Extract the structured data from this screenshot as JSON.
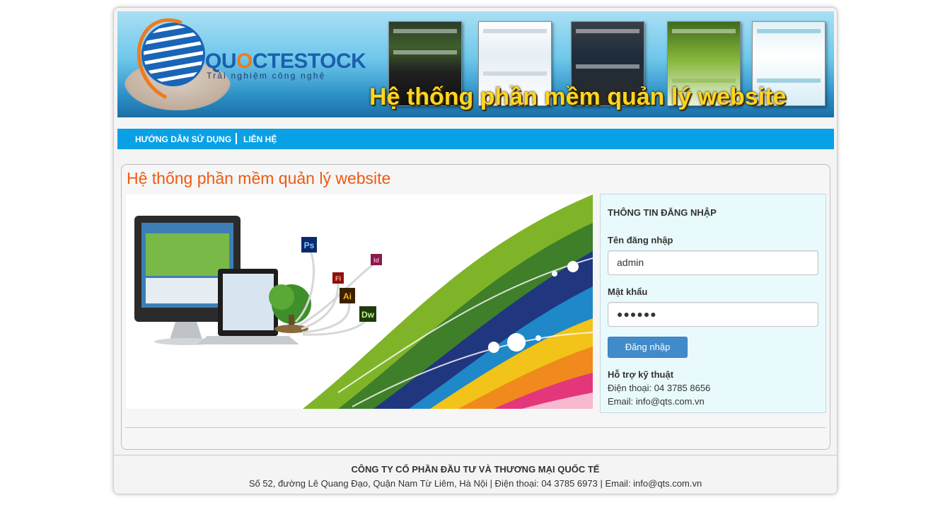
{
  "banner": {
    "logo_text_1": "QU",
    "logo_text_o": "O",
    "logo_text_2": "CTESTOCK",
    "tagline": "Trải nghiệm công nghệ",
    "slogan": "Hệ thống phần mềm quản lý website"
  },
  "nav": {
    "items": [
      {
        "label": "HƯỚNG DẪN SỬ DỤNG"
      },
      {
        "label": "LIÊN HỆ"
      }
    ]
  },
  "main": {
    "title": "Hệ thống phần mềm quản lý website",
    "hero_icons": [
      "Ps",
      "Id",
      "Fl",
      "Ai",
      "Dw"
    ]
  },
  "login": {
    "title": "THÔNG TIN ĐĂNG NHẬP",
    "username_label": "Tên đăng nhập",
    "username_value": "admin",
    "password_label": "Mật khẩu",
    "password_value": "●●●●●●",
    "submit_label": "Đăng nhập",
    "support_title": "Hỗ trợ kỹ thuật",
    "phone": "Điện thoại: 04 3785 8656",
    "email": "Email: info@qts.com.vn"
  },
  "footer": {
    "company": "CÔNG TY CỔ PHẦN ĐẦU TƯ VÀ THƯƠNG MẠI QUỐC TẾ",
    "address": "Số 52, đường Lê Quang Đạo, Quận Nam Từ Liêm, Hà Nội | Điện thoại: 04 3785 6973 | Email: info@qts.com.vn"
  },
  "colors": {
    "nav_bg": "#0aa0e6",
    "title": "#ee5a12",
    "button": "#428bca",
    "login_bg": "#e9fafc",
    "slogan": "#ffd51f"
  }
}
